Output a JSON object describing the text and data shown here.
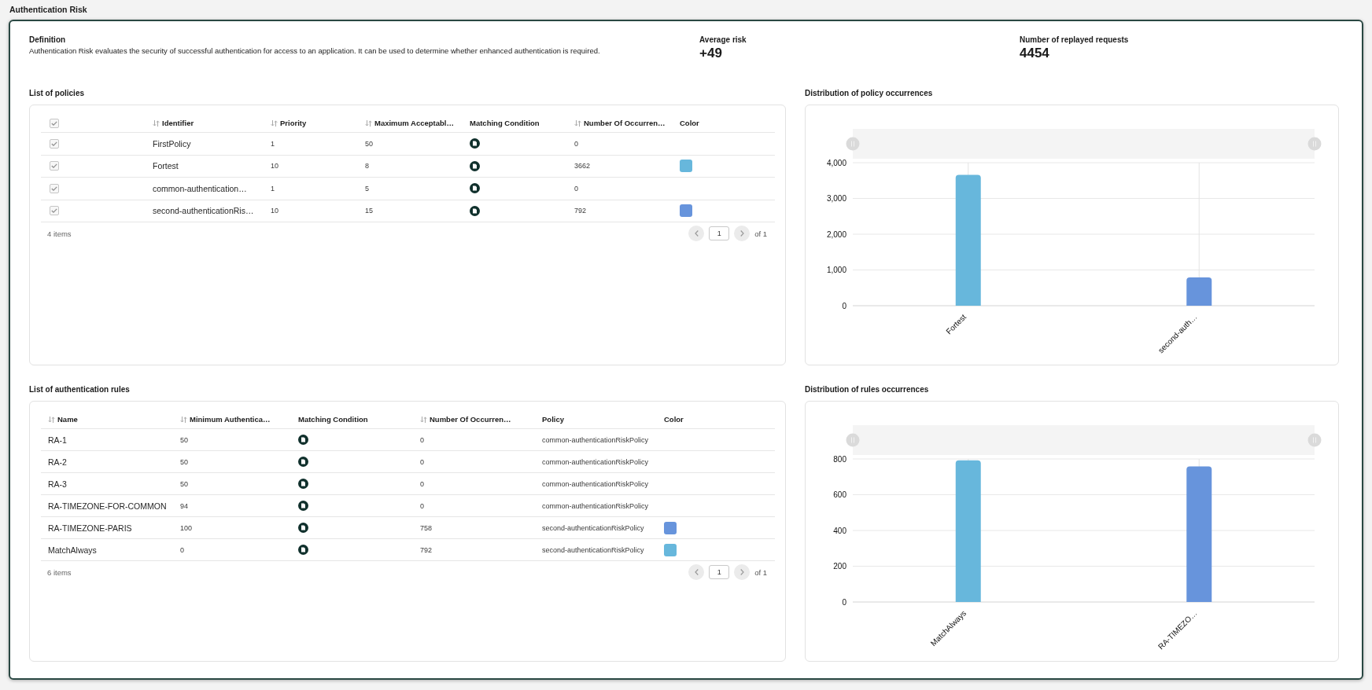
{
  "title": "Authentication Risk",
  "summary": {
    "definition": {
      "label": "Definition",
      "text": "Authentication Risk evaluates the security of successful authentication for access to an application. It can be used to determine whether enhanced authentication is required."
    },
    "stats": [
      {
        "label": "Average risk",
        "value": "+49"
      },
      {
        "label": "Number of replayed requests",
        "value": "4454"
      }
    ]
  },
  "policies": {
    "title": "List of policies",
    "select_all": {
      "checked": true
    },
    "columns": [
      {
        "label": "Identifier",
        "sortable": true
      },
      {
        "label": "Priority",
        "sortable": true
      },
      {
        "label": "Maximum Acceptabl…",
        "sortable": true
      },
      {
        "label": "Matching Condition",
        "sortable": false
      },
      {
        "label": "Number Of Occurren…",
        "sortable": true
      },
      {
        "label": "Color",
        "sortable": false
      }
    ],
    "rows": [
      {
        "checked": true,
        "identifier": "FirstPolicy",
        "priority": "1",
        "maximum": "50",
        "occurrences": "0"
      },
      {
        "checked": true,
        "identifier": "Fortest",
        "priority": "10",
        "maximum": "8",
        "occurrences": "3662",
        "color": "#67b7dc"
      },
      {
        "checked": true,
        "identifier": "common-authentication…",
        "priority": "1",
        "maximum": "5",
        "occurrences": "0"
      },
      {
        "checked": true,
        "identifier": "second-authenticationRis…",
        "priority": "10",
        "maximum": "15",
        "occurrences": "792",
        "color": "#6794dc"
      }
    ],
    "footer": {
      "count": "4 items",
      "page": "1",
      "total": "of 1"
    }
  },
  "policy_chart": {
    "title": "Distribution of policy occurrences",
    "chart_data": {
      "type": "bar",
      "categories": [
        "Fortest",
        "second-auth…"
      ],
      "series": [
        {
          "color": "#67b7dc",
          "values": [
            3662,
            null
          ]
        },
        {
          "color": "#6794dc",
          "values": [
            null,
            792
          ]
        }
      ],
      "stacked": true,
      "grid": true,
      "ylim": [
        0,
        4000
      ],
      "yticks": [
        {
          "value": 0,
          "label": "0"
        },
        {
          "value": 1000,
          "label": "1,000"
        },
        {
          "value": 2000,
          "label": "2,000"
        },
        {
          "value": 3000,
          "label": "3,000"
        },
        {
          "value": 4000,
          "label": "4,000"
        }
      ]
    }
  },
  "rules": {
    "title": "List of authentication rules",
    "columns": [
      {
        "label": "Name",
        "sortable": true
      },
      {
        "label": "Minimum Authentica…",
        "sortable": true
      },
      {
        "label": "Matching Condition",
        "sortable": false
      },
      {
        "label": "Number Of Occurren…",
        "sortable": true
      },
      {
        "label": "Policy",
        "sortable": false
      },
      {
        "label": "Color",
        "sortable": false
      }
    ],
    "rows": [
      {
        "name": "RA-1",
        "minimum": "50",
        "occurrences": "0",
        "policy": "common-authenticationRiskPolicy"
      },
      {
        "name": "RA-2",
        "minimum": "50",
        "occurrences": "0",
        "policy": "common-authenticationRiskPolicy"
      },
      {
        "name": "RA-3",
        "minimum": "50",
        "occurrences": "0",
        "policy": "common-authenticationRiskPolicy"
      },
      {
        "name": "RA-TIMEZONE-FOR-COMMON",
        "minimum": "94",
        "occurrences": "0",
        "policy": "common-authenticationRiskPolicy"
      },
      {
        "name": "RA-TIMEZONE-PARIS",
        "minimum": "100",
        "occurrences": "758",
        "policy": "second-authenticationRiskPolicy",
        "color": "#6794dc"
      },
      {
        "name": "MatchAlways",
        "minimum": "0",
        "occurrences": "792",
        "policy": "second-authenticationRiskPolicy",
        "color": "#67b7dc"
      }
    ],
    "footer": {
      "count": "6 items",
      "page": "1",
      "total": "of 1"
    }
  },
  "rules_chart": {
    "title": "Distribution of rules occurrences",
    "chart_data": {
      "type": "bar",
      "categories": [
        "MatchAlways",
        "RA-TIMEZO…"
      ],
      "series": [
        {
          "color": "#67b7dc",
          "values": [
            792,
            null
          ]
        },
        {
          "color": "#6794dc",
          "values": [
            null,
            758
          ]
        }
      ],
      "stacked": true,
      "grid": true,
      "ylim": [
        0,
        800
      ],
      "yticks": [
        {
          "value": 0,
          "label": "0"
        },
        {
          "value": 200,
          "label": "200"
        },
        {
          "value": 400,
          "label": "400"
        },
        {
          "value": 600,
          "label": "600"
        },
        {
          "value": 800,
          "label": "800"
        }
      ]
    }
  }
}
